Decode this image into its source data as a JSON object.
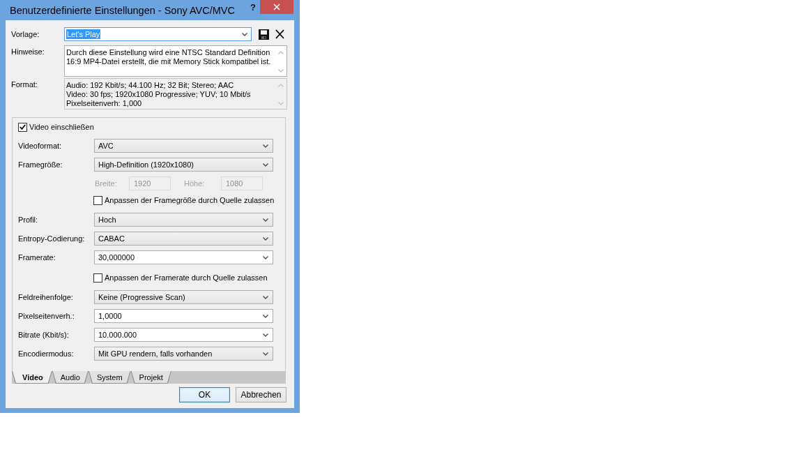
{
  "window": {
    "title": "Benutzerdefinierte Einstellungen - Sony AVC/MVC",
    "help": "?"
  },
  "template": {
    "label": "Vorlage:",
    "value": "Let's Play",
    "focused": true
  },
  "notes": {
    "label": "Hinweise:",
    "lines": [
      "Durch diese Einstellung wird eine NTSC Standard Definition",
      "16:9 MP4-Datei erstellt, die mit Memory Stick kompatibel ist."
    ]
  },
  "format": {
    "label": "Format:",
    "lines": [
      "Audio: 192 Kbit/s; 44.100 Hz; 32 Bit; Stereo; AAC",
      "Video: 30 fps; 1920x1080 Progressive; YUV; 10 Mbit/s",
      "Pixelseitenverh: 1,000"
    ]
  },
  "video_panel": {
    "include": {
      "label": "Video einschließen",
      "checked": true
    },
    "fields": [
      {
        "kind": "select",
        "label": "Videoformat:",
        "value": "AVC"
      },
      {
        "kind": "select",
        "label": "Framegröße:",
        "value": "High-Definition (1920x1080)"
      },
      {
        "kind": "size",
        "disabled": true,
        "width_label": "Breite:",
        "width_value": "1920",
        "height_label": "Höhe:",
        "height_value": "1080"
      },
      {
        "kind": "checkbox",
        "label": "Anpassen der Framegröße durch Quelle zulassen",
        "checked": false
      },
      {
        "kind": "select",
        "label": "Profil:",
        "value": "Hoch"
      },
      {
        "kind": "select",
        "label": "Entropy-Codierung:",
        "value": "CABAC"
      },
      {
        "kind": "combo",
        "label": "Framerate:",
        "value": "30,000000"
      },
      {
        "kind": "checkbox",
        "label": "Anpassen der Framerate durch Quelle zulassen",
        "checked": false
      },
      {
        "kind": "select",
        "label": "Feldreihenfolge:",
        "value": "Keine (Progressive Scan)"
      },
      {
        "kind": "combo",
        "label": "Pixelseitenverh.:",
        "value": "1,0000"
      },
      {
        "kind": "combo",
        "label": "Bitrate (Kbit/s):",
        "value": "10.000.000"
      },
      {
        "kind": "select",
        "label": "Encodiermodus:",
        "value": "Mit GPU rendern, falls vorhanden"
      }
    ]
  },
  "tabs": [
    {
      "label": "Video",
      "selected": true
    },
    {
      "label": "Audio",
      "selected": false
    },
    {
      "label": "System",
      "selected": false
    },
    {
      "label": "Projekt",
      "selected": false
    }
  ],
  "buttons": [
    {
      "label": "OK",
      "default": true
    },
    {
      "label": "Abbrechen",
      "default": false
    }
  ]
}
